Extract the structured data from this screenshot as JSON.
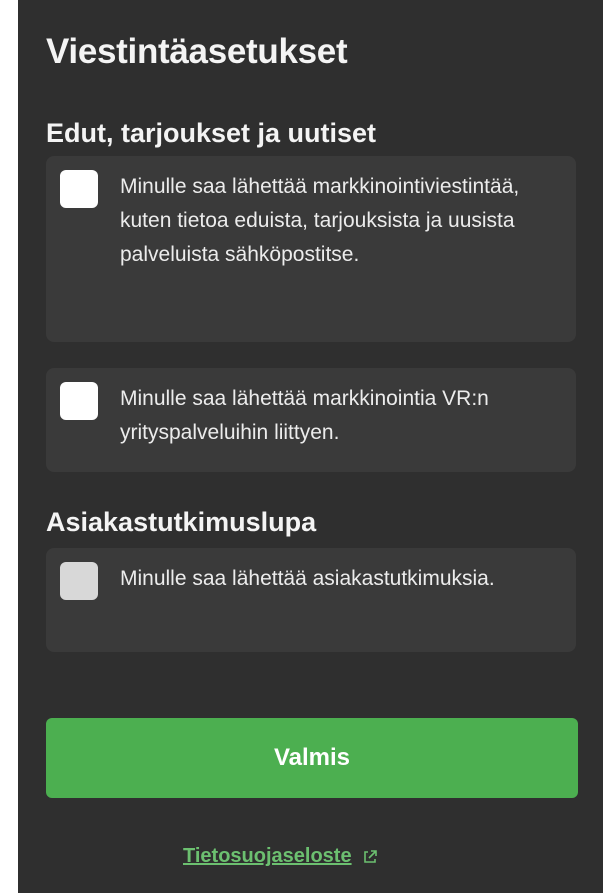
{
  "page_title": "Viestintäasetukset",
  "sections": [
    {
      "heading": "Edut, tarjoukset ja uutiset",
      "options": [
        {
          "label": "Minulle saa lähettää markkinointiviestintää, kuten tietoa eduista, tarjouksista ja uusista palveluista sähköpostitse.",
          "checked": false
        },
        {
          "label": "Minulle saa lähettää markkinointia VR:n yrityspalveluihin liittyen.",
          "checked": false
        }
      ]
    },
    {
      "heading": "Asiakastutkimuslupa",
      "options": [
        {
          "label": "Minulle saa lähettää asiakastutkimuksia.",
          "checked": false
        }
      ]
    }
  ],
  "done_button_label": "Valmis",
  "privacy_link_label": "Tietosuojaseloste",
  "icons": {
    "privacy_link": "external-link-icon"
  },
  "colors": {
    "panel_background": "#2f2f2f",
    "card_background": "#3a3a3a",
    "primary_button": "#4caf50",
    "link": "#6cc070"
  }
}
